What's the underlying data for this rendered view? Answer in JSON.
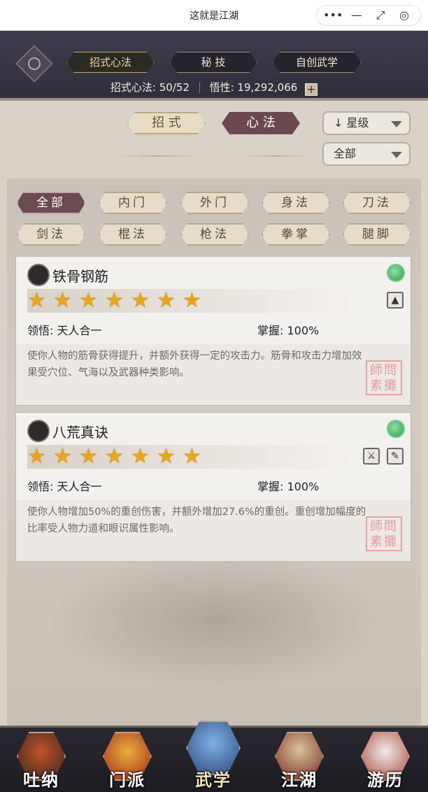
{
  "window": {
    "title": "这就是江湖",
    "controls": [
      "•••",
      "—",
      "⤢",
      "◎"
    ]
  },
  "header": {
    "tabs": [
      {
        "label": "招式心法",
        "active": true
      },
      {
        "label": "秘 技",
        "active": false
      },
      {
        "label": "自创武学",
        "active": false
      }
    ],
    "stats_label": "招式心法:",
    "stats_value": "50/52",
    "insight_label": "悟性:",
    "insight_value": "19,292,066",
    "plus": "+"
  },
  "sortbar": {
    "type_tabs": [
      {
        "label": "招 式",
        "active": false
      },
      {
        "label": "心 法",
        "active": true
      }
    ],
    "sort_select": "星级",
    "sort_arrow": "↓",
    "filter_select": "全部"
  },
  "filters": [
    {
      "label": "全部",
      "active": true
    },
    {
      "label": "内门",
      "active": false
    },
    {
      "label": "外门",
      "active": false
    },
    {
      "label": "身法",
      "active": false
    },
    {
      "label": "刀法",
      "active": false
    },
    {
      "label": "剑法",
      "active": false
    },
    {
      "label": "棍法",
      "active": false
    },
    {
      "label": "枪法",
      "active": false
    },
    {
      "label": "拳掌",
      "active": false
    },
    {
      "label": "腿脚",
      "active": false
    }
  ],
  "skills": [
    {
      "name": "铁骨钢筋",
      "icon": "yin-yang-icon",
      "stars": 7,
      "weapons": [
        "▲"
      ],
      "comprehension_label": "领悟:",
      "comprehension": "天人合一",
      "mastery_label": "掌握:",
      "mastery": "100%",
      "description": "使你人物的筋骨获得提升，并额外获得一定的攻击力。筋骨和攻击力增加效果受穴位、气海以及武器种类影响。",
      "seal": "師問 素攤"
    },
    {
      "name": "八荒真诀",
      "icon": "crossed-weapons-icon",
      "stars": 7,
      "weapons": [
        "⚔",
        "✎"
      ],
      "comprehension_label": "领悟:",
      "comprehension": "天人合一",
      "mastery_label": "掌握:",
      "mastery": "100%",
      "description": "使你人物增加50%的重创伤害，并额外增加27.6%的重创。重创增加幅度的比率受人物力道和眼识属性影响。",
      "seal": "師問 素攤"
    }
  ],
  "bottom_nav": [
    {
      "label": "吐纳",
      "icon": "monk-icon",
      "active": false
    },
    {
      "label": "门派",
      "icon": "flag-icon",
      "active": false
    },
    {
      "label": "武学",
      "icon": "book-icon",
      "active": true
    },
    {
      "label": "江湖",
      "icon": "straw-hat-icon",
      "active": false
    },
    {
      "label": "游历",
      "icon": "horse-icon",
      "active": false
    }
  ],
  "colors": {
    "header_bg": "#3f3d4d",
    "panel_bg": "#d1cbc3",
    "active_tab": "#6a4b50",
    "star": "#e9a51c"
  }
}
